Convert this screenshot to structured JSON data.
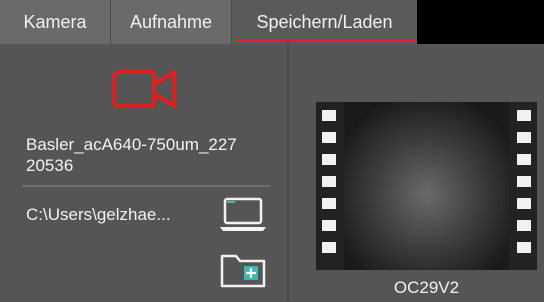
{
  "tabs": [
    {
      "label": "Kamera"
    },
    {
      "label": "Aufnahme"
    },
    {
      "label": "Speichern/Laden"
    }
  ],
  "active_tab": "Speichern/Laden",
  "camera": {
    "icon": "video-camera-icon",
    "device_name": "Basler_acA640-750um_227\n20536"
  },
  "save_path": {
    "path": "C:\\Users\\gelzhae...",
    "browse_icon": "laptop-icon",
    "new_folder_icon": "folder-plus-icon"
  },
  "preview": {
    "icon": "film-strip-icon",
    "label": "OC29V2"
  },
  "colors": {
    "accent": "#e02020",
    "teal": "#3fb8b0",
    "panel": "#555555",
    "tab": "#6a6a6a"
  }
}
